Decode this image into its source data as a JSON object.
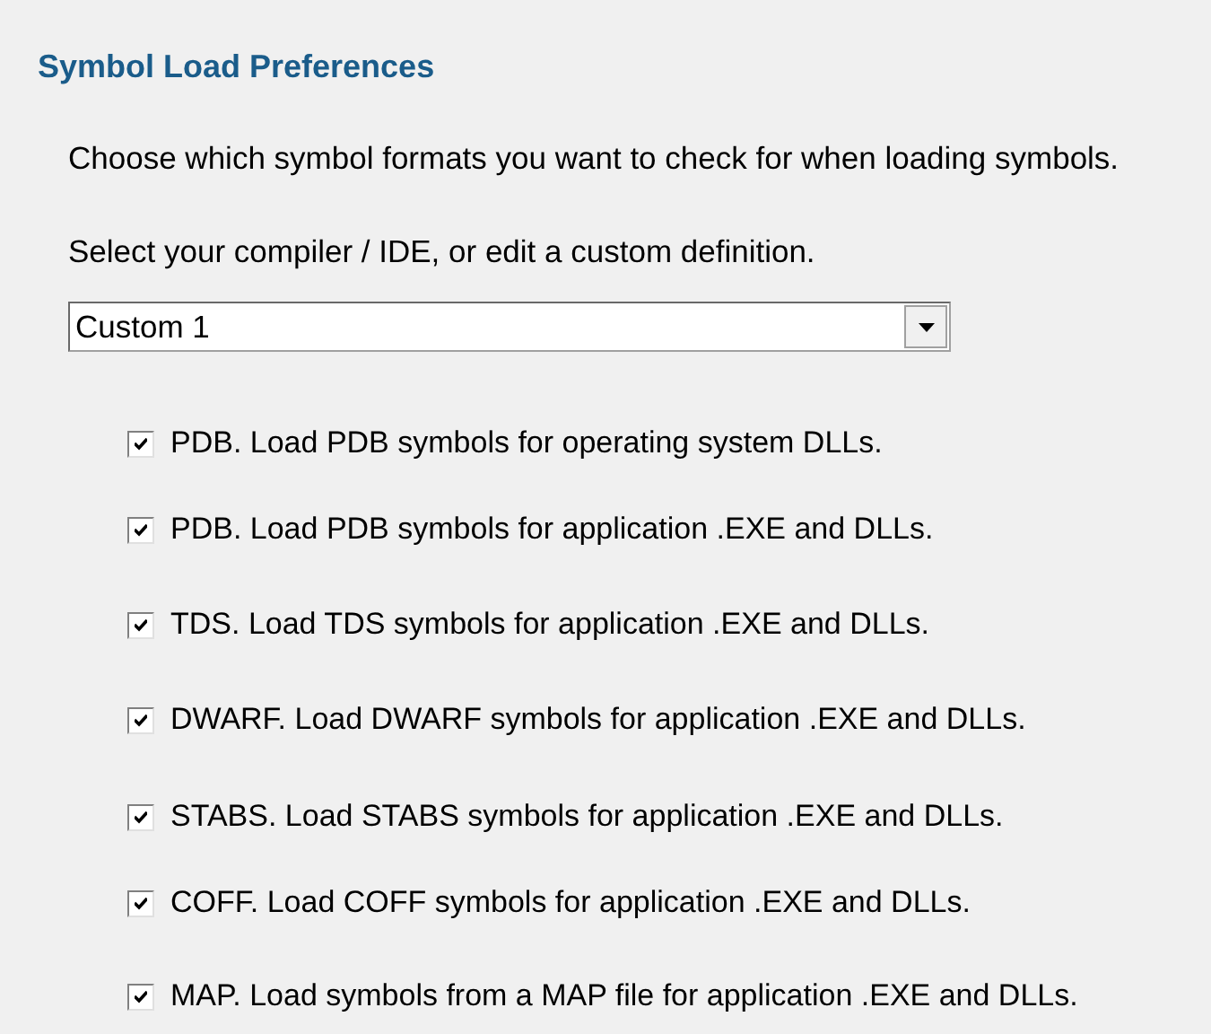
{
  "title": "Symbol Load Preferences",
  "intro": "Choose which symbol formats you want to check for when loading symbols.",
  "prompt": "Select your compiler / IDE, or edit a custom definition.",
  "compiler_select": {
    "value": "Custom 1"
  },
  "options": [
    {
      "label": "PDB. Load PDB symbols for operating system DLLs.",
      "checked": true
    },
    {
      "label": "PDB. Load PDB symbols for application .EXE and DLLs.",
      "checked": true
    },
    {
      "label": "TDS. Load TDS symbols for application .EXE and DLLs.",
      "checked": true
    },
    {
      "label": "DWARF. Load DWARF symbols for application .EXE and DLLs.",
      "checked": true
    },
    {
      "label": "STABS. Load STABS symbols for application .EXE and DLLs.",
      "checked": true
    },
    {
      "label": "COFF. Load COFF symbols for application .EXE and DLLs.",
      "checked": true
    },
    {
      "label": "MAP. Load symbols from a MAP file for application .EXE and DLLs.",
      "checked": true
    }
  ]
}
